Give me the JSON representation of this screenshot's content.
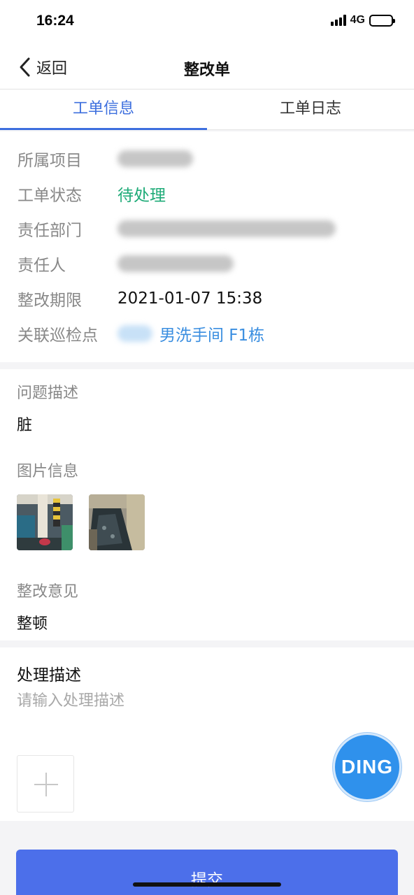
{
  "status_bar": {
    "time": "16:24",
    "network": "4G"
  },
  "nav": {
    "back_label": "返回",
    "title": "整改单"
  },
  "tabs": [
    {
      "label": "工单信息",
      "active": true
    },
    {
      "label": "工单日志",
      "active": false
    }
  ],
  "info": {
    "project_label": "所属项目",
    "status_label": "工单状态",
    "status_value": "待处理",
    "department_label": "责任部门",
    "owner_label": "责任人",
    "deadline_label": "整改期限",
    "deadline_value": "2021-01-07 15:38",
    "checkpoint_label": "关联巡检点",
    "checkpoint_value": "男洗手间 F1栋"
  },
  "problem": {
    "label": "问题描述",
    "value": "脏"
  },
  "images": {
    "label": "图片信息"
  },
  "advice": {
    "label": "整改意见",
    "value": "整顿"
  },
  "handle": {
    "title": "处理描述",
    "placeholder": "请输入处理描述"
  },
  "ding_label": "DING",
  "submit_label": "提交",
  "colors": {
    "accent": "#3d6fde",
    "status_green": "#1fab78",
    "link_blue": "#3a8ee0",
    "submit": "#4c6fea",
    "ding": "#2f91ec"
  },
  "icons": [
    "chevron-left-icon",
    "signal-icon",
    "battery-icon",
    "plus-icon"
  ]
}
